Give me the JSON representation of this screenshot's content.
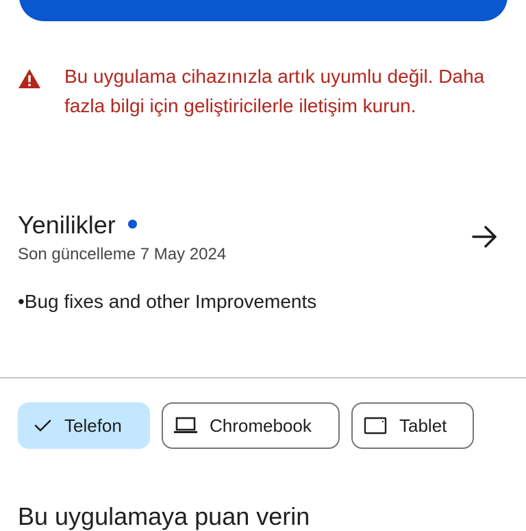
{
  "colors": {
    "primary": "#0b57d0",
    "error": "#b3261e",
    "chip_selected_bg": "#c2e7ff",
    "divider": "#c4c7c5"
  },
  "warning": {
    "icon": "warning-triangle-icon",
    "text": "Bu uygulama cihazınızla artık uyumlu değil. Daha fazla bilgi için geliştiricilerle iletişim kurun."
  },
  "whats_new": {
    "title": "Yenilikler",
    "subtitle": "Son güncelleme 7 May 2024",
    "notes": "•Bug fixes and other Improvements",
    "arrow_icon": "arrow-right-icon"
  },
  "device_chips": [
    {
      "label": "Telefon",
      "icon": "check-icon",
      "selected": true
    },
    {
      "label": "Chromebook",
      "icon": "laptop-icon",
      "selected": false
    },
    {
      "label": "Tablet",
      "icon": "tablet-icon",
      "selected": false
    }
  ],
  "rate_section": {
    "title": "Bu uygulamaya puan verin"
  }
}
